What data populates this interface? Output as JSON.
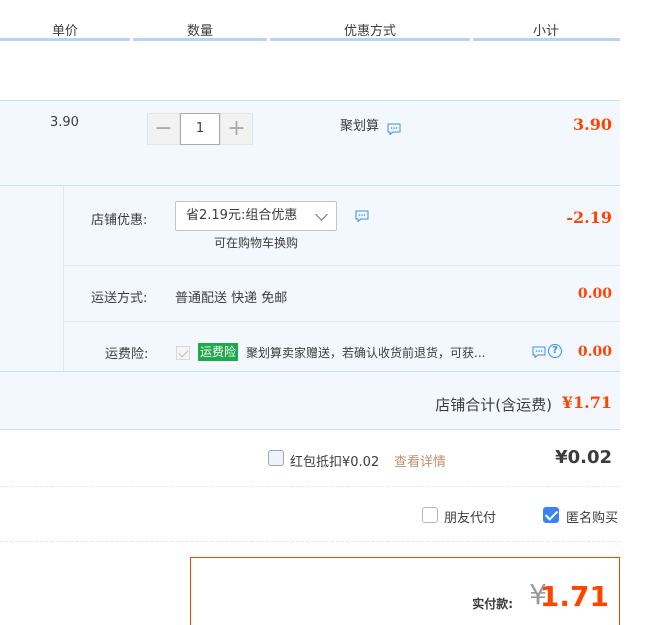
{
  "header": {
    "unit_price": "单价",
    "quantity": "数量",
    "promotion": "优惠方式",
    "subtotal": "小计"
  },
  "item": {
    "unit_price": "3.90",
    "quantity": "1",
    "minus": "−",
    "plus": "+",
    "promotion": "聚划算",
    "subtotal": "3.90"
  },
  "shop": {
    "coupon_label": "店铺优惠:",
    "coupon_selected": "省2.19元:组合优惠",
    "coupon_note": "可在购物车换购",
    "coupon_amount": "-2.19",
    "shipping_label": "运送方式:",
    "shipping_value": "普通配送 快递 免邮",
    "shipping_amount": "0.00",
    "insurance_label": "运费险:",
    "insurance_tag": "运费险",
    "insurance_desc": "聚划算卖家赠送，若确认收货前退货，可获...",
    "insurance_amount": "0.00",
    "total_label": "店铺合计(含运费)",
    "total_value": "¥1.71"
  },
  "redpacket": {
    "label": "红包抵扣¥0.02",
    "link": "查看详情",
    "value": "¥0.02"
  },
  "options": {
    "friend_pay": "朋友代付",
    "anonymous": "匿名购买"
  },
  "payment": {
    "label": "实付款:",
    "currency": "¥",
    "amount": "1.71"
  },
  "colors": {
    "accent_red": "#ff4400",
    "header_line": "#b7d3ef",
    "row_bg": "#f3f8fe",
    "insurance_green": "#1fa94a"
  }
}
